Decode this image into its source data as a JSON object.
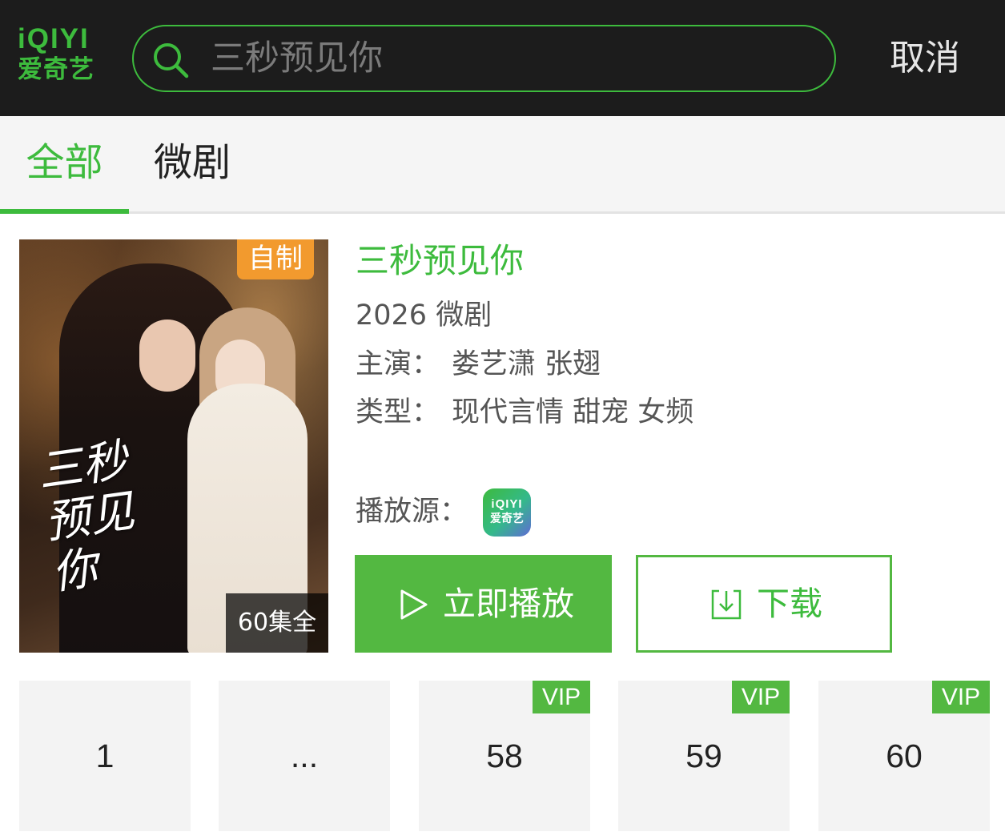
{
  "header": {
    "logo_en": "iQIYI",
    "logo_cn": "爱奇艺",
    "search_value": "三秒预见你",
    "cancel_label": "取消"
  },
  "tabs": [
    {
      "label": "全部",
      "active": true
    },
    {
      "label": "微剧",
      "active": false
    }
  ],
  "result": {
    "badge": "自制",
    "poster_title_text": "三秒预见你",
    "episode_count": "60集全",
    "title": "三秒预见你",
    "year_type": "2026 微剧",
    "cast_label": "主演：",
    "cast": "娄艺潇 张翅",
    "genre_label": "类型：",
    "genres": "现代言情 甜宠 女频",
    "source_label": "播放源：",
    "source_logo_en": "iQIYI",
    "source_logo_cn": "爱奇艺",
    "play_label": "立即播放",
    "download_label": "下载"
  },
  "episodes": [
    {
      "label": "1",
      "vip": ""
    },
    {
      "label": "...",
      "vip": ""
    },
    {
      "label": "58",
      "vip": "VIP"
    },
    {
      "label": "59",
      "vip": "VIP"
    },
    {
      "label": "60",
      "vip": "VIP"
    }
  ],
  "colors": {
    "brand_green": "#3dbb3d",
    "button_green": "#53b841",
    "header_bg": "#1c1c1c",
    "badge_orange": "#f29a2e"
  }
}
